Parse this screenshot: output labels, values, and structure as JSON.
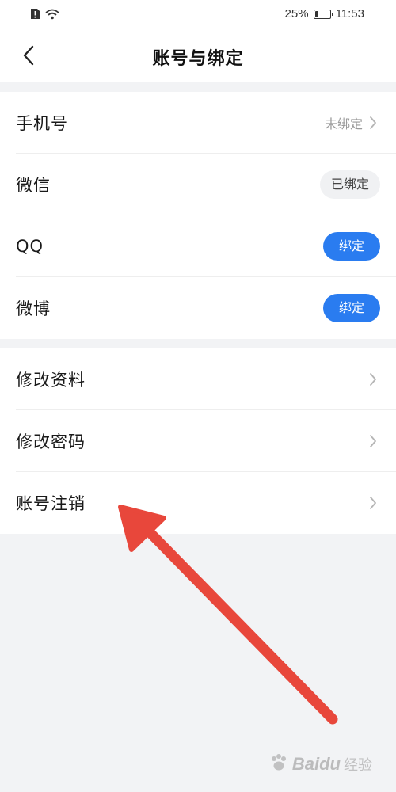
{
  "status_bar": {
    "battery_percent_text": "25%",
    "battery_level": 0.25,
    "time": "11:53",
    "icons": [
      "sim-alert-icon",
      "wifi-icon",
      "battery-icon"
    ]
  },
  "nav": {
    "title": "账号与绑定",
    "back_icon": "chevron-left-icon"
  },
  "section_bindings": {
    "phone": {
      "label": "手机号",
      "status": "未绑定"
    },
    "wechat": {
      "label": "微信",
      "status": "已绑定"
    },
    "qq": {
      "label": "QQ",
      "button": "绑定"
    },
    "weibo": {
      "label": "微博",
      "button": "绑定"
    }
  },
  "section_account": {
    "edit_profile": {
      "label": "修改资料"
    },
    "change_password": {
      "label": "修改密码"
    },
    "deactivate": {
      "label": "账号注销"
    }
  },
  "watermark": {
    "brand": "Baidu",
    "sub": "经验"
  },
  "colors": {
    "accent": "#2a7cf0",
    "background": "#f2f3f5",
    "arrow": "#e8473b"
  }
}
